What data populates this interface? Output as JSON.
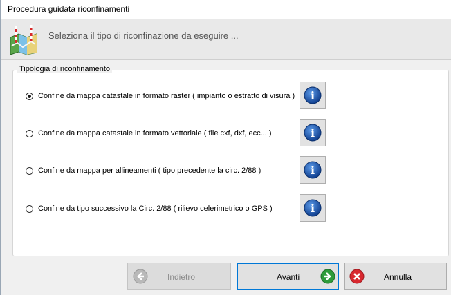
{
  "window": {
    "title": "Procedura guidata riconfinamenti"
  },
  "header": {
    "subtitle": "Seleziona il tipo di riconfinazione da eseguire ...",
    "logo_icon": "map-pins-icon"
  },
  "group": {
    "legend": "Tipologia di riconfinamento",
    "options": [
      {
        "label": "Confine da mappa catastale in formato raster ( impianto o estratto di visura )",
        "selected": true
      },
      {
        "label": "Confine da mappa catastale in formato vettoriale ( file cxf, dxf, ecc... )",
        "selected": false
      },
      {
        "label": "Confine da mappa per allineamenti ( tipo precedente la circ. 2/88 )",
        "selected": false
      },
      {
        "label": "Confine da tipo successivo la Circ. 2/88 ( rilievo celerimetrico o GPS )",
        "selected": false
      }
    ],
    "info_icon": "info-icon"
  },
  "buttons": {
    "back": {
      "label": "Indietro",
      "icon": "arrow-left-icon",
      "enabled": false
    },
    "next": {
      "label": "Avanti",
      "icon": "arrow-right-icon",
      "enabled": true
    },
    "cancel": {
      "label": "Annulla",
      "icon": "close-icon",
      "enabled": true
    }
  },
  "colors": {
    "info_blue": "#1f5fb8",
    "next_green": "#2e9b3a",
    "cancel_red": "#d8282f",
    "focus_border": "#0078d7"
  }
}
